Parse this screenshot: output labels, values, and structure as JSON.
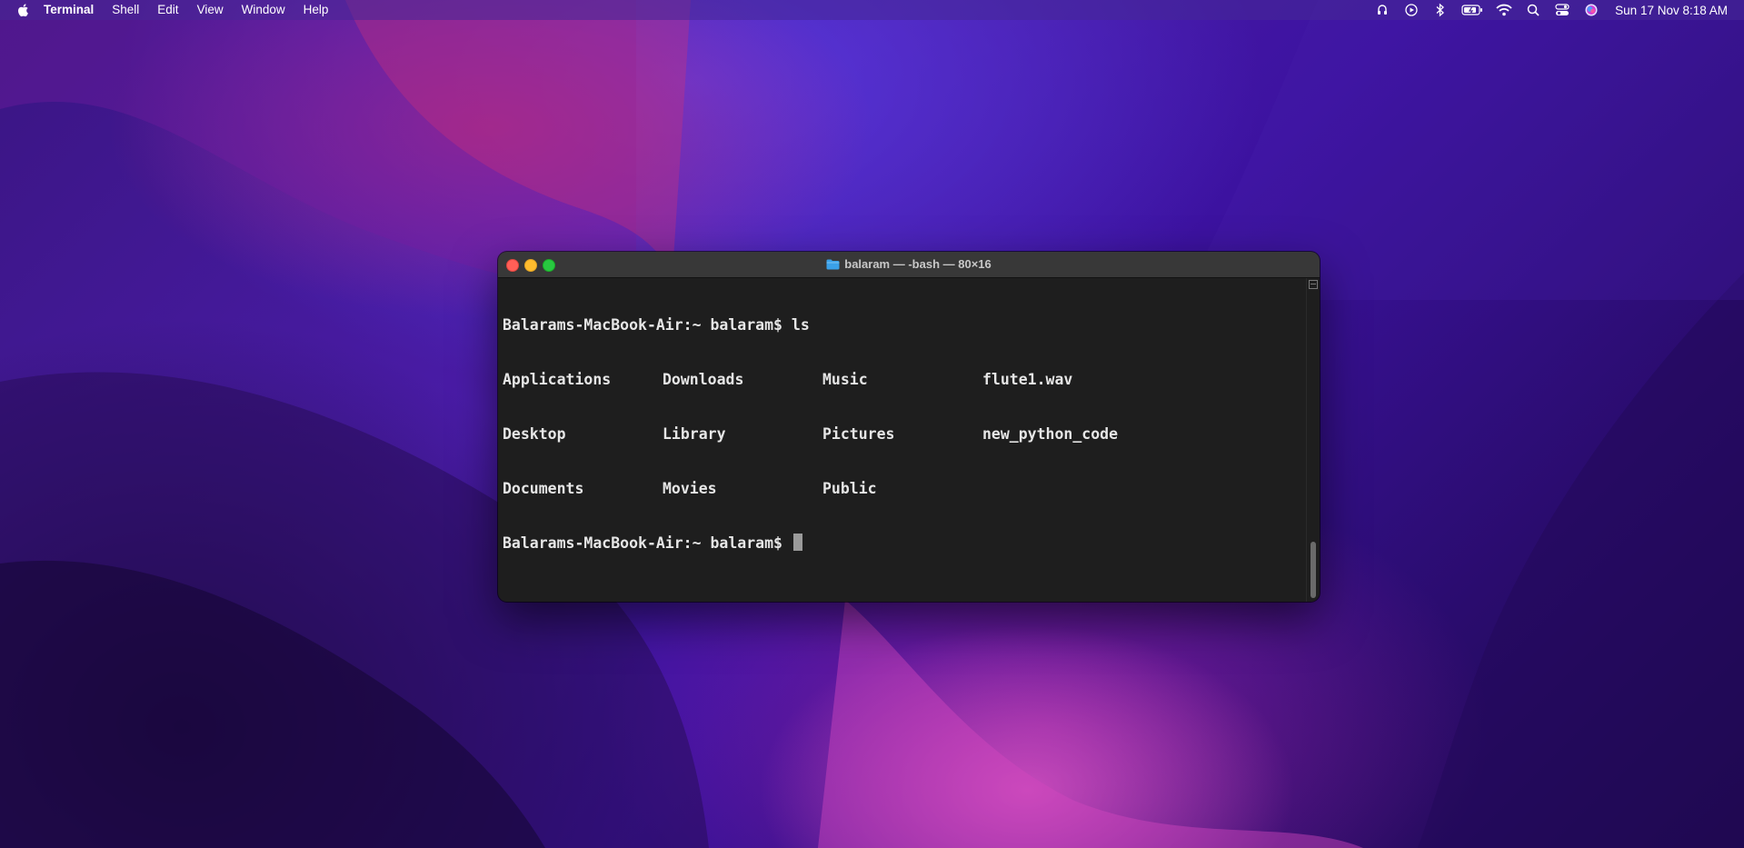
{
  "menubar": {
    "app_name": "Terminal",
    "items": [
      "Shell",
      "Edit",
      "View",
      "Window",
      "Help"
    ],
    "status_icons": [
      "airpods-icon",
      "now-playing-icon",
      "bluetooth-icon",
      "battery-icon",
      "wifi-icon",
      "spotlight-search-icon",
      "control-center-icon",
      "siri-icon"
    ],
    "clock": "Sun 17 Nov  8:18 AM"
  },
  "window": {
    "title": "balaram — -bash — 80×16"
  },
  "terminal": {
    "prompt": "Balarams-MacBook-Air:~ balaram$ ",
    "command": "ls",
    "listing": [
      [
        "Applications",
        "Downloads",
        "Music",
        "flute1.wav"
      ],
      [
        "Desktop",
        "Library",
        "Pictures",
        "new_python_code"
      ],
      [
        "Documents",
        "Movies",
        "Public"
      ]
    ]
  },
  "colors": {
    "terminal_bg": "#1e1e1e",
    "terminal_text": "#e6e6e6",
    "titlebar": "#383838",
    "close": "#ff5f57",
    "minimize": "#febc2e",
    "zoom": "#28c840"
  }
}
